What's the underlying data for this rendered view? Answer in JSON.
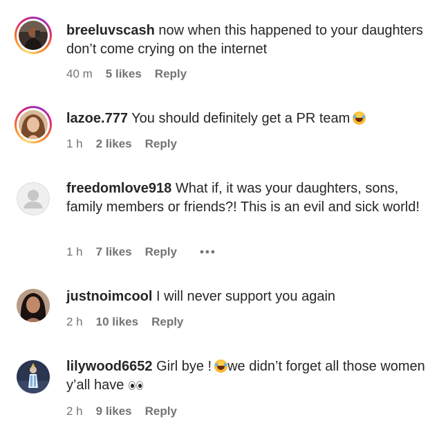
{
  "comments": [
    {
      "username": "breeluvscash",
      "text": "now when this happened to your daughters don’t come crying on the internet",
      "time": "40 m",
      "likes": "5 likes",
      "reply": "Reply",
      "avatar": "profile-photo"
    },
    {
      "username": "lazoe.777",
      "text": "You should definitely get a PR team",
      "time": "1 h",
      "likes": "2 likes",
      "reply": "Reply",
      "avatar": "profile-photo",
      "emoji": "face-with-tears-of-joy"
    },
    {
      "username": "freedomlove918",
      "text": "What if, it was your daughters, sons, family members or friends?! This is an evil and sick world!",
      "time": "1 h",
      "likes": "7 likes",
      "reply": "Reply",
      "more": "•••",
      "avatar": "default-avatar"
    },
    {
      "username": "justnoimcool",
      "text": "I will never support you again",
      "time": "2 h",
      "likes": "10 likes",
      "reply": "Reply",
      "avatar": "profile-photo"
    },
    {
      "username": "lilywood6652",
      "text_a": "Girl bye !",
      "text_b": "we didn’t forget all those women y’all have",
      "time": "2 h",
      "likes": "9 likes",
      "reply": "Reply",
      "avatar": "profile-photo",
      "emojis": [
        "face-with-tears-of-joy",
        "eyes"
      ]
    }
  ],
  "colors": {
    "text": "#262626",
    "muted": "#737373",
    "story_ring": [
      "#feda75",
      "#fa7e1e",
      "#d62976",
      "#962fbf"
    ]
  }
}
